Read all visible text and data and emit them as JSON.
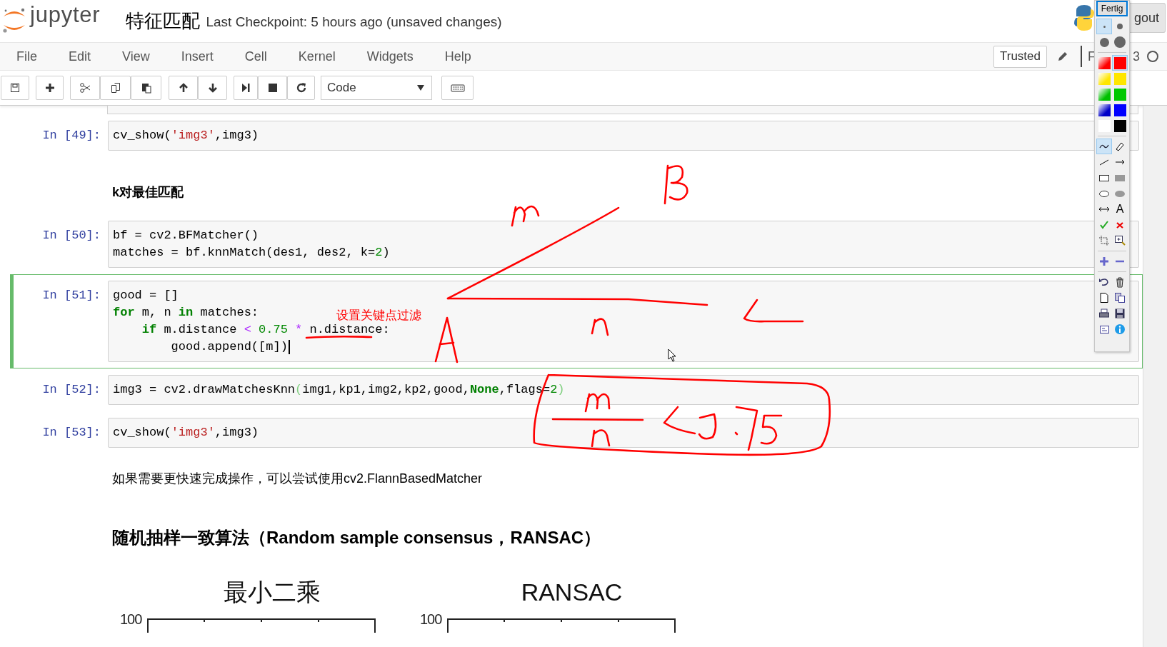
{
  "header": {
    "logo_text": "jupyter",
    "notebook_name": "特征匹配",
    "checkpoint": "Last Checkpoint: 5 hours ago (unsaved changes)",
    "logout_button": "gout"
  },
  "menu": [
    {
      "label": "File"
    },
    {
      "label": "Edit"
    },
    {
      "label": "View"
    },
    {
      "label": "Insert"
    },
    {
      "label": "Cell"
    },
    {
      "label": "Kernel"
    },
    {
      "label": "Widgets"
    },
    {
      "label": "Help"
    }
  ],
  "menubar_right": {
    "trusted": "Trusted",
    "kernel_name": "F",
    "kernel_version": "3",
    "kernel_busy": false
  },
  "toolbar": {
    "cell_type": "Code"
  },
  "cells": [
    {
      "kind": "code",
      "prompt": "In [49]:",
      "selected": false,
      "lines": [
        [
          {
            "kind": "plain",
            "text": "cv_show("
          },
          {
            "kind": "str",
            "text": "'img3'"
          },
          {
            "kind": "plain",
            "text": ",img3)"
          }
        ]
      ]
    },
    {
      "kind": "subheading",
      "text": "k对最佳匹配"
    },
    {
      "kind": "code",
      "prompt": "In [50]:",
      "selected": false,
      "lines": [
        [
          {
            "kind": "plain",
            "text": "bf = cv2.BFMatcher()"
          }
        ],
        [
          {
            "kind": "plain",
            "text": "matches = bf.knnMatch(des1, des2, k="
          },
          {
            "kind": "num",
            "text": "2"
          },
          {
            "kind": "plain",
            "text": ")"
          }
        ]
      ]
    },
    {
      "kind": "code",
      "prompt": "In [51]:",
      "selected": true,
      "lines": [
        [
          {
            "kind": "plain",
            "text": "good = []"
          }
        ],
        [
          {
            "kind": "kw",
            "text": "for"
          },
          {
            "kind": "plain",
            "text": " m, n "
          },
          {
            "kind": "kw",
            "text": "in"
          },
          {
            "kind": "plain",
            "text": " matches:"
          }
        ],
        [
          {
            "kind": "kw",
            "text": "    if"
          },
          {
            "kind": "plain",
            "text": " m.distance "
          },
          {
            "kind": "op",
            "text": "< "
          },
          {
            "kind": "num",
            "text": "0.75"
          },
          {
            "kind": "op",
            "text": " * "
          },
          {
            "kind": "plain",
            "text": "n.distance:"
          }
        ],
        [
          {
            "kind": "plain",
            "text": "        good.append([m])"
          }
        ]
      ]
    },
    {
      "kind": "code",
      "prompt": "In [52]:",
      "selected": false,
      "lines": [
        [
          {
            "kind": "plain",
            "text": "img3 = cv2.drawMatchesKnn"
          },
          {
            "kind": "bracket",
            "text": "("
          },
          {
            "kind": "plain",
            "text": "img1,kp1,img2,kp2,good,"
          },
          {
            "kind": "kw",
            "text": "None"
          },
          {
            "kind": "plain",
            "text": ",flags="
          },
          {
            "kind": "num",
            "text": "2"
          },
          {
            "kind": "bracket",
            "text": ")"
          }
        ]
      ]
    },
    {
      "kind": "code",
      "prompt": "In [53]:",
      "selected": false,
      "lines": [
        [
          {
            "kind": "plain",
            "text": "cv_show("
          },
          {
            "kind": "str",
            "text": "'img3'"
          },
          {
            "kind": "plain",
            "text": ",img3)"
          }
        ]
      ]
    },
    {
      "kind": "paragraph",
      "text": "如果需要更快速完成操作，可以尝试使用cv2.FlannBasedMatcher"
    },
    {
      "kind": "heading",
      "text": "随机抽样一致算法（Random sample consensus，RANSAC）"
    },
    {
      "kind": "figure",
      "panels": [
        {
          "title": "最小二乘",
          "ytick": "100"
        },
        {
          "title": "RANSAC",
          "ytick": "100"
        }
      ]
    }
  ],
  "annotation": {
    "note": "设置关键点过滤"
  },
  "palette": {
    "done_button": "Fertig",
    "sizes": [
      {
        "selected": true
      },
      {
        "selected": false
      },
      {
        "selected": false
      },
      {
        "selected": false
      }
    ],
    "colors": [
      {
        "kind": "gradient",
        "color": "#ff0000",
        "selected": false
      },
      {
        "kind": "solid",
        "color": "#ff0000",
        "selected": true
      },
      {
        "kind": "gradient",
        "color": "#ffe600",
        "selected": false
      },
      {
        "kind": "solid",
        "color": "#ffe600",
        "selected": false
      },
      {
        "kind": "gradient",
        "color": "#00c000",
        "selected": false
      },
      {
        "kind": "solid",
        "color": "#00c800",
        "selected": false
      },
      {
        "kind": "gradient",
        "color": "#0000c8",
        "selected": false
      },
      {
        "kind": "solid",
        "color": "#0000ff",
        "selected": false
      },
      {
        "kind": "solid",
        "color": "#ffffff",
        "selected": false
      },
      {
        "kind": "solid",
        "color": "#000000",
        "selected": false
      }
    ],
    "tool_groups": [
      {
        "tools": [
          {
            "selected": true
          },
          {
            "selected": false
          },
          {
            "selected": false
          },
          {
            "selected": false
          },
          {
            "selected": false
          },
          {
            "selected": false
          },
          {
            "selected": false
          },
          {
            "selected": false
          },
          {
            "selected": false
          },
          {
            "selected": false,
            "label": "A"
          },
          {
            "selected": false
          },
          {
            "selected": false
          },
          {
            "selected": false
          },
          {
            "selected": false
          }
        ]
      },
      {
        "tools": [
          {
            "selected": false
          },
          {
            "selected": false
          }
        ]
      },
      {
        "tools": [
          {
            "selected": false
          },
          {
            "selected": false
          },
          {
            "selected": false
          },
          {
            "selected": false
          },
          {
            "selected": false
          },
          {
            "selected": false
          },
          {
            "selected": false
          },
          {
            "selected": false
          }
        ]
      }
    ]
  }
}
